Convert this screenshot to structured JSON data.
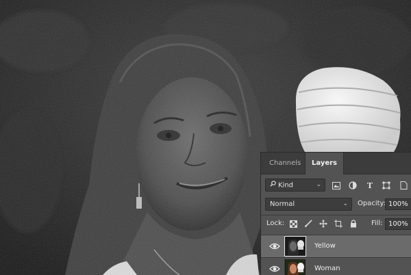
{
  "layers_panel": {
    "tabs": [
      {
        "label": "Channels",
        "active": false
      },
      {
        "label": "Layers",
        "active": true
      }
    ],
    "filter": {
      "value": "Kind",
      "icon": "search-icon"
    },
    "filter_icons": [
      "image-filter-icon",
      "adjustment-filter-icon",
      "type-filter-icon",
      "shape-filter-icon",
      "smart-object-filter-icon"
    ],
    "blend_mode": "Normal",
    "opacity_label": "Opacity:",
    "opacity_value": "100%",
    "lock_label": "Lock:",
    "lock_icons": [
      "lock-transparent-icon",
      "lock-paint-icon",
      "lock-position-icon",
      "lock-artboard-icon",
      "lock-all-icon"
    ],
    "fill_label": "Fill:",
    "fill_value": "100%",
    "layers": [
      {
        "name": "Yellow",
        "visible": true,
        "selected": true,
        "thumb": "black-and-white-thumbnail"
      },
      {
        "name": "Woman",
        "visible": true,
        "selected": false,
        "thumb": "color-photo-thumbnail"
      }
    ]
  },
  "colors": {
    "panel_bg": "#535353",
    "tab_bar_bg": "#3c3c3c",
    "selected_layer_bg": "#6b6b6b",
    "field_bg": "#3d3d3d"
  }
}
